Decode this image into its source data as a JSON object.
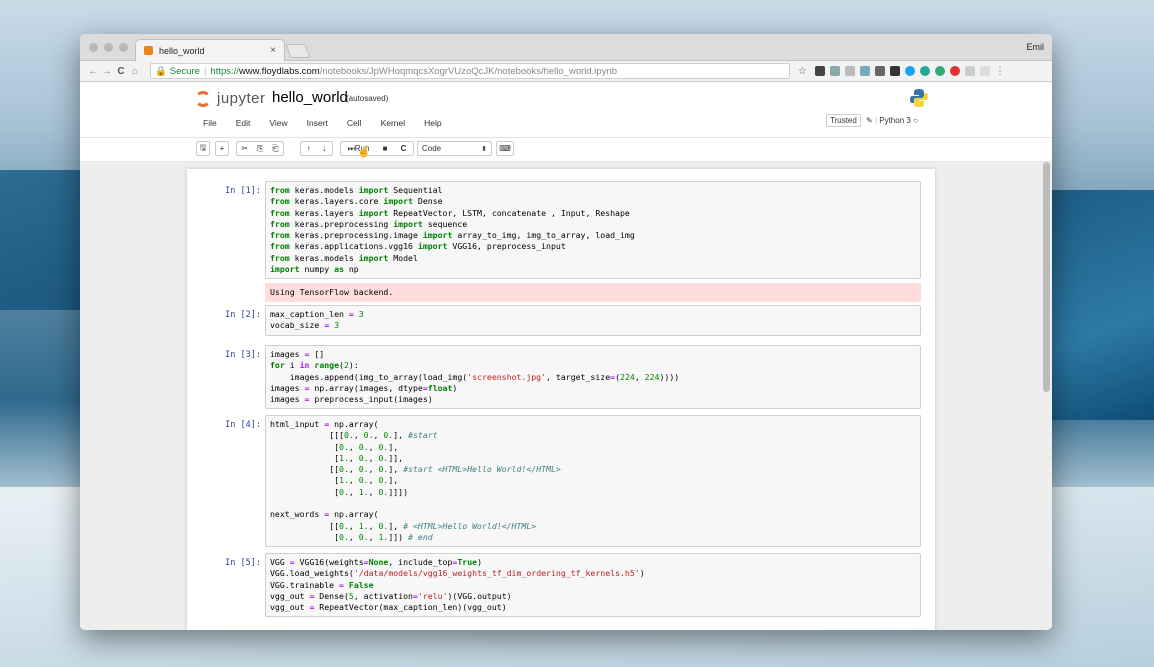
{
  "browser": {
    "tab_title": "hello_world",
    "tab_close": "×",
    "user": "Emil",
    "nav_back": "←",
    "nav_forward": "→",
    "nav_reload": "C",
    "nav_home": "⌂",
    "secure_label": "Secure",
    "url_protocol": "https://",
    "url_host": "www.floydlabs.com",
    "url_path": "/notebooks/JpWHoqmqcsXogrVUzoQcJK/notebooks/hello_world.ipynb",
    "star": "☆"
  },
  "jupyter": {
    "logo_text": "jupyter",
    "notebook_name": "hello_world",
    "autosave_status": "(autosaved)",
    "menu": [
      "File",
      "Edit",
      "View",
      "Insert",
      "Cell",
      "Kernel",
      "Help"
    ],
    "trusted": "Trusted",
    "kernel": "Python 3"
  },
  "toolbar": {
    "save_icon": "🖫",
    "add_icon": "+",
    "cut_icon": "✂",
    "copy_icon": "⎘",
    "paste_icon": "⎗",
    "up_icon": "↑",
    "down_icon": "↓",
    "run_label": "Run",
    "stop_icon": "■",
    "restart_icon": "C",
    "cell_type": "Code",
    "keyboard_icon": "⌨"
  },
  "cells": [
    {
      "prompt": "In [1]:",
      "lines": [
        [
          [
            "kw",
            "from"
          ],
          [
            "t",
            " keras.models "
          ],
          [
            "kw",
            "import"
          ],
          [
            "t",
            " Sequential"
          ]
        ],
        [
          [
            "kw",
            "from"
          ],
          [
            "t",
            " keras.layers.core "
          ],
          [
            "kw",
            "import"
          ],
          [
            "t",
            " Dense"
          ]
        ],
        [
          [
            "kw",
            "from"
          ],
          [
            "t",
            " keras.layers "
          ],
          [
            "kw",
            "import"
          ],
          [
            "t",
            " RepeatVector, LSTM, concatenate , Input, Reshape"
          ]
        ],
        [
          [
            "kw",
            "from"
          ],
          [
            "t",
            " keras.preprocessing "
          ],
          [
            "kw",
            "import"
          ],
          [
            "t",
            " sequence"
          ]
        ],
        [
          [
            "kw",
            "from"
          ],
          [
            "t",
            " keras.preprocessing.image "
          ],
          [
            "kw",
            "import"
          ],
          [
            "t",
            " array_to_img, img_to_array, load_img"
          ]
        ],
        [
          [
            "kw",
            "from"
          ],
          [
            "t",
            " keras.applications.vgg16 "
          ],
          [
            "kw",
            "import"
          ],
          [
            "t",
            " VGG16, preprocess_input"
          ]
        ],
        [
          [
            "kw",
            "from"
          ],
          [
            "t",
            " keras.models "
          ],
          [
            "kw",
            "import"
          ],
          [
            "t",
            " Model"
          ]
        ],
        [
          [
            "kw",
            "import"
          ],
          [
            "t",
            " numpy "
          ],
          [
            "kw",
            "as"
          ],
          [
            "t",
            " np"
          ]
        ]
      ],
      "stderr": "Using TensorFlow backend."
    },
    {
      "prompt": "In [2]:",
      "lines": [
        [
          [
            "t",
            "max_caption_len "
          ],
          [
            "op",
            "="
          ],
          [
            "t",
            " "
          ],
          [
            "num",
            "3"
          ]
        ],
        [
          [
            "t",
            "vocab_size "
          ],
          [
            "op",
            "="
          ],
          [
            "t",
            " "
          ],
          [
            "num",
            "3"
          ]
        ]
      ]
    },
    {
      "prompt": "In [3]:",
      "lines": [
        [
          [
            "t",
            "images "
          ],
          [
            "op",
            "="
          ],
          [
            "t",
            " []"
          ]
        ],
        [
          [
            "kw",
            "for"
          ],
          [
            "t",
            " i "
          ],
          [
            "op",
            "in"
          ],
          [
            "t",
            " "
          ],
          [
            "kw",
            "range"
          ],
          [
            "t",
            "("
          ],
          [
            "num",
            "2"
          ],
          [
            "t",
            "):"
          ]
        ],
        [
          [
            "t",
            "    images.append(img_to_array(load_img("
          ],
          [
            "str",
            "'screenshot.jpg'"
          ],
          [
            "t",
            ", target_size"
          ],
          [
            "op",
            "="
          ],
          [
            "t",
            "("
          ],
          [
            "num",
            "224"
          ],
          [
            "t",
            ", "
          ],
          [
            "num",
            "224"
          ],
          [
            "t",
            "))))"
          ]
        ],
        [
          [
            "t",
            "images "
          ],
          [
            "op",
            "="
          ],
          [
            "t",
            " np.array(images, dtype"
          ],
          [
            "op",
            "="
          ],
          [
            "kw",
            "float"
          ],
          [
            "t",
            ")"
          ]
        ],
        [
          [
            "t",
            "images "
          ],
          [
            "op",
            "="
          ],
          [
            "t",
            " preprocess_input(images)"
          ]
        ]
      ]
    },
    {
      "prompt": "In [4]:",
      "lines": [
        [
          [
            "t",
            "html_input "
          ],
          [
            "op",
            "="
          ],
          [
            "t",
            " np.array("
          ]
        ],
        [
          [
            "t",
            "            [[["
          ],
          [
            "num",
            "0."
          ],
          [
            "t",
            ", "
          ],
          [
            "num",
            "0."
          ],
          [
            "t",
            ", "
          ],
          [
            "num",
            "0."
          ],
          [
            "t",
            "], "
          ],
          [
            "com",
            "#start"
          ]
        ],
        [
          [
            "t",
            "             ["
          ],
          [
            "num",
            "0."
          ],
          [
            "t",
            ", "
          ],
          [
            "num",
            "0."
          ],
          [
            "t",
            ", "
          ],
          [
            "num",
            "0."
          ],
          [
            "t",
            "],"
          ]
        ],
        [
          [
            "t",
            "             ["
          ],
          [
            "num",
            "1."
          ],
          [
            "t",
            ", "
          ],
          [
            "num",
            "0."
          ],
          [
            "t",
            ", "
          ],
          [
            "num",
            "0."
          ],
          [
            "t",
            "]],"
          ]
        ],
        [
          [
            "t",
            "            [["
          ],
          [
            "num",
            "0."
          ],
          [
            "t",
            ", "
          ],
          [
            "num",
            "0."
          ],
          [
            "t",
            ", "
          ],
          [
            "num",
            "0."
          ],
          [
            "t",
            "], "
          ],
          [
            "com",
            "#start <HTML>Hello World!</HTML>"
          ]
        ],
        [
          [
            "t",
            "             ["
          ],
          [
            "num",
            "1."
          ],
          [
            "t",
            ", "
          ],
          [
            "num",
            "0."
          ],
          [
            "t",
            ", "
          ],
          [
            "num",
            "0."
          ],
          [
            "t",
            "],"
          ]
        ],
        [
          [
            "t",
            "             ["
          ],
          [
            "num",
            "0."
          ],
          [
            "t",
            ", "
          ],
          [
            "num",
            "1."
          ],
          [
            "t",
            ", "
          ],
          [
            "num",
            "0."
          ],
          [
            "t",
            "]]])"
          ]
        ],
        [
          [
            "t",
            ""
          ]
        ],
        [
          [
            "t",
            "next_words "
          ],
          [
            "op",
            "="
          ],
          [
            "t",
            " np.array("
          ]
        ],
        [
          [
            "t",
            "            [["
          ],
          [
            "num",
            "0."
          ],
          [
            "t",
            ", "
          ],
          [
            "num",
            "1."
          ],
          [
            "t",
            ", "
          ],
          [
            "num",
            "0."
          ],
          [
            "t",
            "], "
          ],
          [
            "com",
            "# <HTML>Hello World!</HTML>"
          ]
        ],
        [
          [
            "t",
            "             ["
          ],
          [
            "num",
            "0."
          ],
          [
            "t",
            ", "
          ],
          [
            "num",
            "0."
          ],
          [
            "t",
            ", "
          ],
          [
            "num",
            "1."
          ],
          [
            "t",
            "]]) "
          ],
          [
            "com",
            "# end"
          ]
        ]
      ]
    },
    {
      "prompt": "In [5]:",
      "lines": [
        [
          [
            "t",
            "VGG "
          ],
          [
            "op",
            "="
          ],
          [
            "t",
            " VGG16(weights"
          ],
          [
            "op",
            "="
          ],
          [
            "kw",
            "None"
          ],
          [
            "t",
            ", include_top"
          ],
          [
            "op",
            "="
          ],
          [
            "kw",
            "True"
          ],
          [
            "t",
            ")"
          ]
        ],
        [
          [
            "t",
            "VGG.load_weights("
          ],
          [
            "str",
            "'/data/models/vgg16_weights_tf_dim_ordering_tf_kernels.h5'"
          ],
          [
            "t",
            ")"
          ]
        ],
        [
          [
            "t",
            "VGG.trainable "
          ],
          [
            "op",
            "="
          ],
          [
            "t",
            " "
          ],
          [
            "kw",
            "False"
          ]
        ],
        [
          [
            "t",
            "vgg_out "
          ],
          [
            "op",
            "="
          ],
          [
            "t",
            " Dense("
          ],
          [
            "num",
            "5"
          ],
          [
            "t",
            ", activation"
          ],
          [
            "op",
            "="
          ],
          [
            "str",
            "'relu'"
          ],
          [
            "t",
            ")(VGG.output)"
          ]
        ],
        [
          [
            "t",
            "vgg_out "
          ],
          [
            "op",
            "="
          ],
          [
            "t",
            " RepeatVector(max_caption_len)(vgg_out)"
          ]
        ]
      ]
    }
  ]
}
